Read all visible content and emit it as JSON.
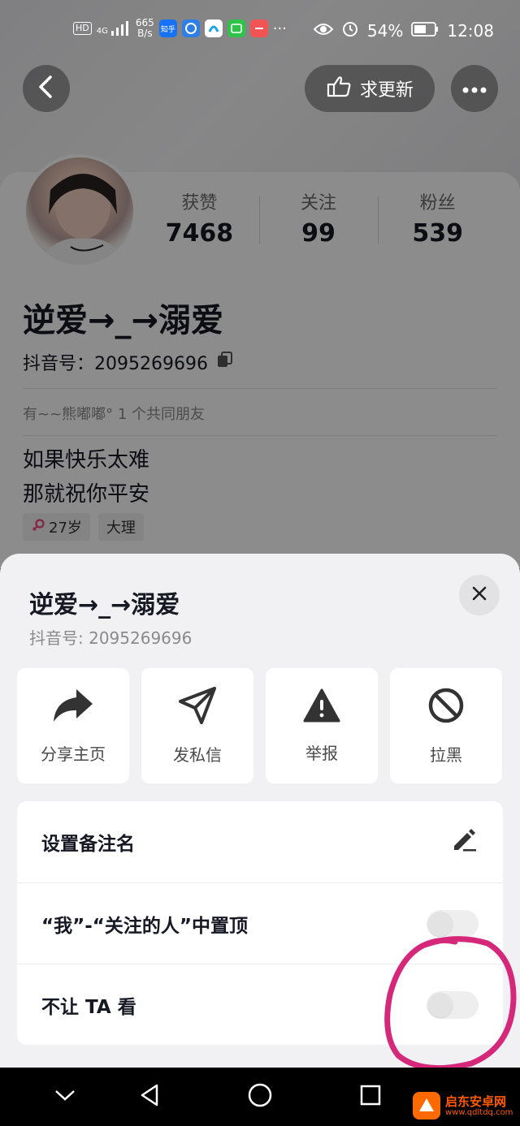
{
  "status_bar": {
    "hd": "HD",
    "signal": "4G",
    "speed_value": "665",
    "speed_unit": "B/s",
    "zhihu": "知乎",
    "more": "···",
    "battery": "54%",
    "time": "12:08"
  },
  "profile": {
    "request_update": "求更新",
    "stats": [
      {
        "label": "获赞",
        "value": "7468"
      },
      {
        "label": "关注",
        "value": "99"
      },
      {
        "label": "粉丝",
        "value": "539"
      }
    ],
    "nickname": "逆爱→_→溺爱",
    "douyin_id": "抖音号：2095269696",
    "mutual_friends": "有~~熊嘟嘟° 1 个共同朋友",
    "bio_line1": "如果快乐太难",
    "bio_line2": "那就祝你平安",
    "tag_age": "27岁",
    "tag_location": "大理"
  },
  "sheet": {
    "name": "逆爱→_→溺爱",
    "id": "抖音号: 2095269696",
    "actions": [
      {
        "label": "分享主页",
        "icon": "share-icon"
      },
      {
        "label": "发私信",
        "icon": "send-icon"
      },
      {
        "label": "举报",
        "icon": "warning-icon"
      },
      {
        "label": "拉黑",
        "icon": "block-icon"
      }
    ],
    "settings": [
      {
        "label": "设置备注名"
      },
      {
        "label": "“我”-“关注的人”中置顶",
        "on": false
      },
      {
        "label": "不让 TA 看",
        "on": false
      }
    ]
  },
  "watermark": {
    "title": "启东安卓网",
    "url": "www.qdltdq.com"
  },
  "colors": {
    "annotation": "#d6287a",
    "sheet_bg": "#f1f1f3"
  }
}
